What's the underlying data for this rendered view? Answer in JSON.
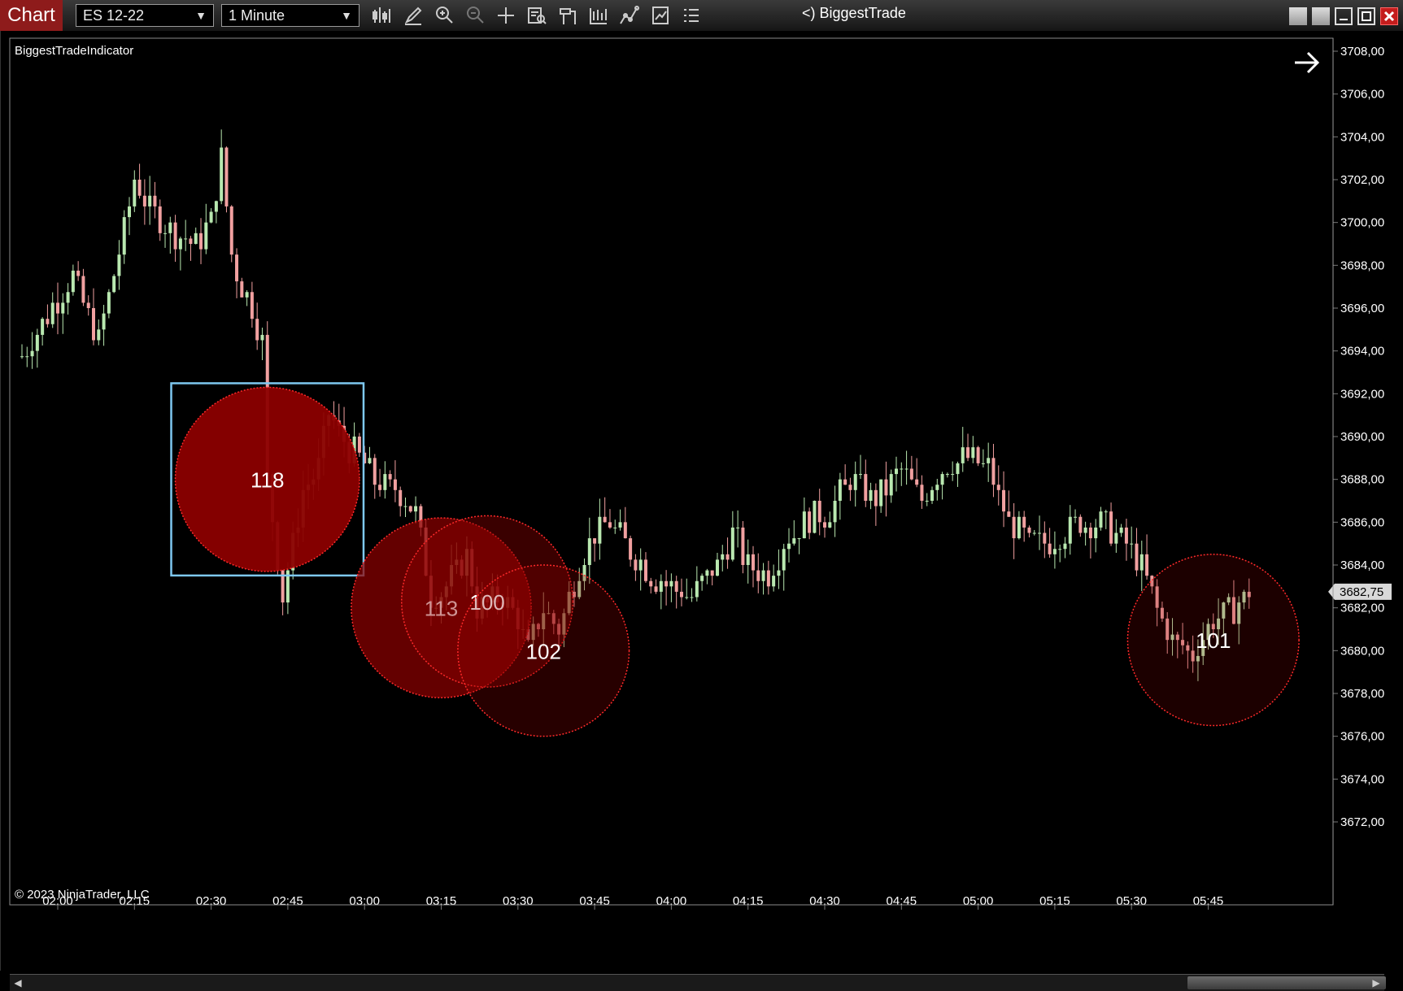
{
  "toolbar": {
    "chart_tab": "Chart",
    "instrument": "ES 12-22",
    "interval": "1 Minute",
    "indicator_prefix": "<)",
    "indicator_name": "BiggestTrade",
    "tool_icons": [
      "bar-type-icon",
      "draw-icon",
      "zoom-in-icon",
      "zoom-out-icon",
      "crosshair-icon",
      "data-box-icon",
      "properties-icon",
      "strategies-icon",
      "drawing-tools-icon",
      "chart-trader-icon",
      "list-icon"
    ],
    "window_buttons": [
      "tile-icon",
      "restore-icon",
      "minimize-icon",
      "maximize-icon",
      "close-icon"
    ]
  },
  "chart": {
    "indicator_label": "BiggestTradeIndicator",
    "copyright": "© 2023 NinjaTrader, LLC",
    "price_labels": [
      "3708,00",
      "3706,00",
      "3704,00",
      "3702,00",
      "3700,00",
      "3698,00",
      "3696,00",
      "3694,00",
      "3692,00",
      "3690,00",
      "3688,00",
      "3686,00",
      "3684,00",
      "3682,00",
      "3680,00",
      "3678,00",
      "3676,00",
      "3674,00",
      "3672,00"
    ],
    "time_labels": [
      "02:00",
      "02:15",
      "02:30",
      "02:45",
      "03:00",
      "03:15",
      "03:30",
      "03:45",
      "04:00",
      "04:15",
      "04:30",
      "04:45",
      "05:00",
      "05:15",
      "05:30",
      "05:45"
    ],
    "last_price": "3682,75",
    "colors": {
      "up": "#b9e8b0",
      "down": "#f1a0a0",
      "bubble_fill": "#8b0000",
      "bubble_stroke": "#ff2a2a",
      "selection": "#7ec8f0",
      "axis": "#777777"
    }
  },
  "chart_data": {
    "type": "candlestick",
    "ylim": [
      3672,
      3708
    ],
    "x_ticks": [
      "02:00",
      "02:15",
      "02:30",
      "02:45",
      "03:00",
      "03:15",
      "03:30",
      "03:45",
      "04:00",
      "04:15",
      "04:30",
      "04:45",
      "05:00",
      "05:15",
      "05:30",
      "05:45"
    ],
    "anchors": [
      [
        "01:53",
        3693.8
      ],
      [
        "02:00",
        3696.5
      ],
      [
        "02:03",
        3697.5
      ],
      [
        "02:08",
        3694.5
      ],
      [
        "02:10",
        3696.5
      ],
      [
        "02:13",
        3699.5
      ],
      [
        "02:15",
        3702.0
      ],
      [
        "02:18",
        3700.5
      ],
      [
        "02:23",
        3699.5
      ],
      [
        "02:27",
        3699.0
      ],
      [
        "02:30",
        3700.0
      ],
      [
        "02:32",
        3703.0
      ],
      [
        "02:34",
        3698.5
      ],
      [
        "02:36",
        3697.0
      ],
      [
        "02:38",
        3696.0
      ],
      [
        "02:40",
        3694.5
      ],
      [
        "02:41",
        3688.0
      ],
      [
        "02:44",
        3682.5
      ],
      [
        "02:48",
        3687.5
      ],
      [
        "02:51",
        3688.5
      ],
      [
        "02:53",
        3691.0
      ],
      [
        "02:57",
        3689.5
      ],
      [
        "03:02",
        3688.0
      ],
      [
        "03:06",
        3687.5
      ],
      [
        "03:10",
        3686.5
      ],
      [
        "03:13",
        3682.5
      ],
      [
        "03:16",
        3683.0
      ],
      [
        "03:20",
        3684.5
      ],
      [
        "03:22",
        3682.0
      ],
      [
        "03:27",
        3682.5
      ],
      [
        "03:30",
        3681.5
      ],
      [
        "03:32",
        3680.0
      ],
      [
        "03:35",
        3682.0
      ],
      [
        "03:38",
        3681.0
      ],
      [
        "03:42",
        3684.0
      ],
      [
        "03:45",
        3685.5
      ],
      [
        "03:48",
        3686.0
      ],
      [
        "03:51",
        3685.0
      ],
      [
        "03:56",
        3683.5
      ],
      [
        "04:00",
        3683.0
      ],
      [
        "04:04",
        3682.5
      ],
      [
        "04:09",
        3684.0
      ],
      [
        "04:12",
        3685.5
      ],
      [
        "04:15",
        3684.0
      ],
      [
        "04:19",
        3683.5
      ],
      [
        "04:22",
        3685.0
      ],
      [
        "04:26",
        3686.0
      ],
      [
        "04:31",
        3686.5
      ],
      [
        "04:35",
        3688.0
      ],
      [
        "04:40",
        3687.0
      ],
      [
        "04:45",
        3688.5
      ],
      [
        "04:49",
        3687.0
      ],
      [
        "04:53",
        3688.5
      ],
      [
        "04:58",
        3689.0
      ],
      [
        "05:02",
        3688.5
      ],
      [
        "05:06",
        3686.0
      ],
      [
        "05:10",
        3685.0
      ],
      [
        "05:14",
        3685.0
      ],
      [
        "05:19",
        3686.0
      ],
      [
        "05:24",
        3686.0
      ],
      [
        "05:29",
        3685.0
      ],
      [
        "05:32",
        3684.0
      ],
      [
        "05:35",
        3682.0
      ],
      [
        "05:38",
        3680.5
      ],
      [
        "05:42",
        3679.8
      ],
      [
        "05:46",
        3681.5
      ],
      [
        "05:50",
        3682.0
      ],
      [
        "05:53",
        3682.75
      ]
    ],
    "bubbles": [
      {
        "label": "118",
        "time": "02:41",
        "price": 3688.0,
        "radius_price": 4.3,
        "alpha": 0.95,
        "selected": true
      },
      {
        "label": "113",
        "time": "03:15",
        "price": 3682.0,
        "radius_price": 4.2,
        "alpha": 0.72
      },
      {
        "label": "100",
        "time": "03:24",
        "price": 3682.3,
        "radius_price": 4.0,
        "alpha": 0.42
      },
      {
        "label": "102",
        "time": "03:35",
        "price": 3680.0,
        "radius_price": 4.0,
        "alpha": 0.28
      },
      {
        "label": "101",
        "time": "05:46",
        "price": 3680.5,
        "radius_price": 4.0,
        "alpha": 0.2
      }
    ]
  }
}
